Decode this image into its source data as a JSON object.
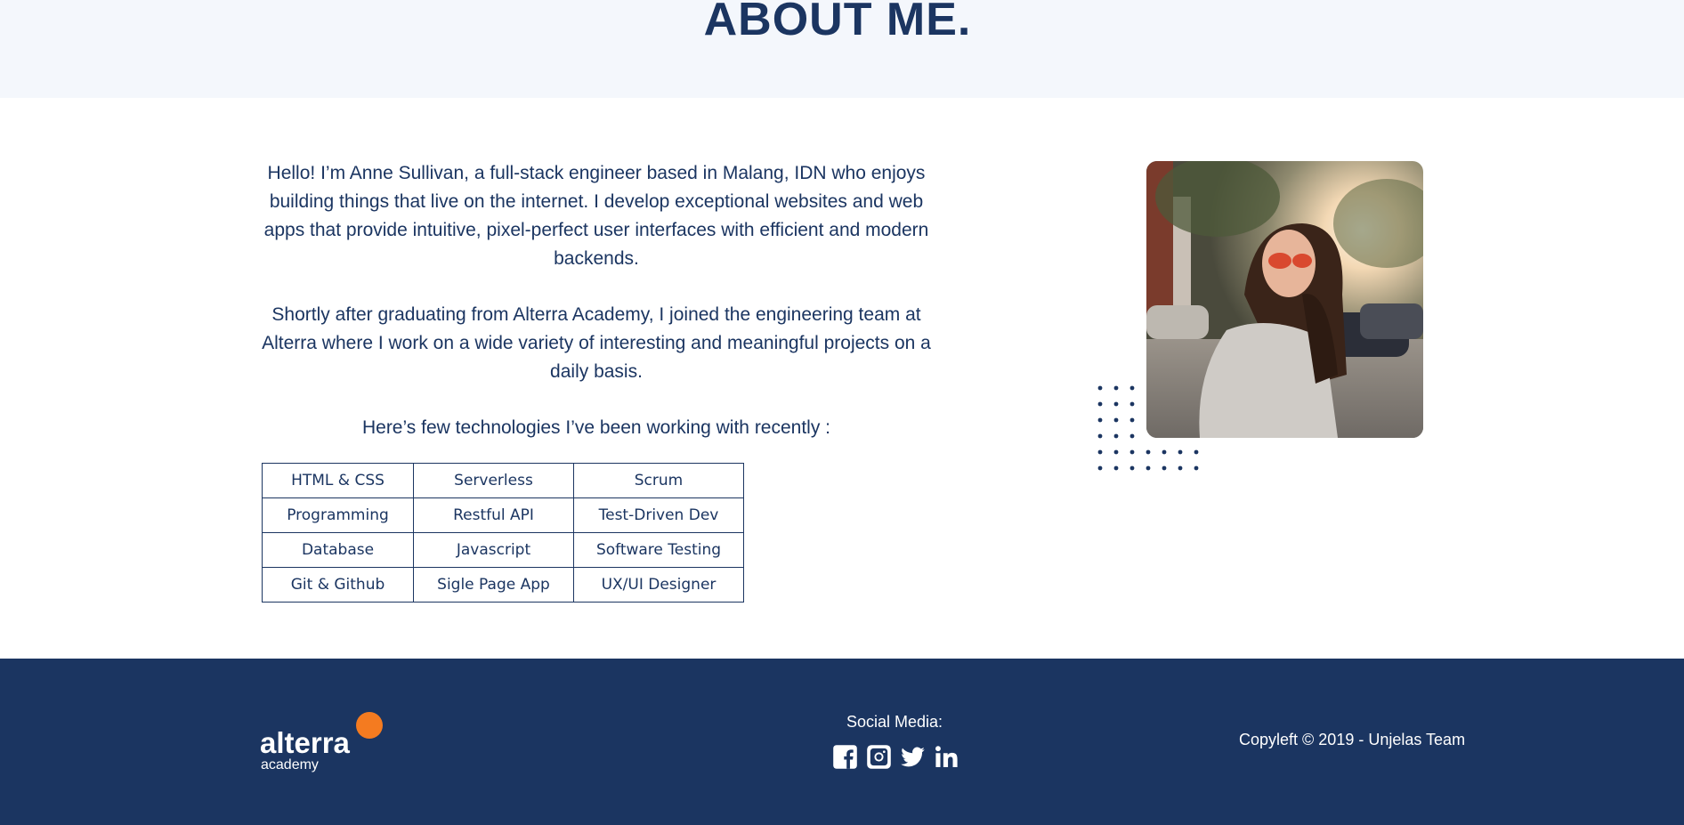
{
  "hero": {
    "title": "ABOUT ME."
  },
  "about": {
    "paragraph1": "Hello! I’m Anne Sullivan, a full-stack engineer based in Malang, IDN who enjoys building things that live on the internet. I develop exceptional websites and web apps that provide intuitive, pixel-perfect user interfaces with efficient and modern backends.",
    "paragraph2": "Shortly after graduating from Alterra Academy, I joined the engineering team at Alterra where I work on a wide variety of interesting and meaningful projects on a daily basis.",
    "tech_intro": "Here’s few technologies I’ve been working with recently :"
  },
  "technologies": [
    [
      "HTML & CSS",
      "Serverless",
      "Scrum"
    ],
    [
      "Programming",
      "Restful API",
      "Test-Driven Dev"
    ],
    [
      "Database",
      "Javascript",
      "Software Testing"
    ],
    [
      "Git & Github",
      "Sigle Page App",
      "UX/UI Designer"
    ]
  ],
  "footer": {
    "logo": {
      "brand": "alterra",
      "sub": "academy"
    },
    "social_title": "Social Media:",
    "social_icons": [
      "facebook-icon",
      "instagram-icon",
      "twitter-icon",
      "linkedin-icon"
    ],
    "copyright": "Copyleft © 2019 - Unjelas Team"
  },
  "colors": {
    "navy": "#1b3561",
    "hero_bg": "#f4f7fc",
    "accent_orange": "#f47b20",
    "white": "#ffffff"
  }
}
